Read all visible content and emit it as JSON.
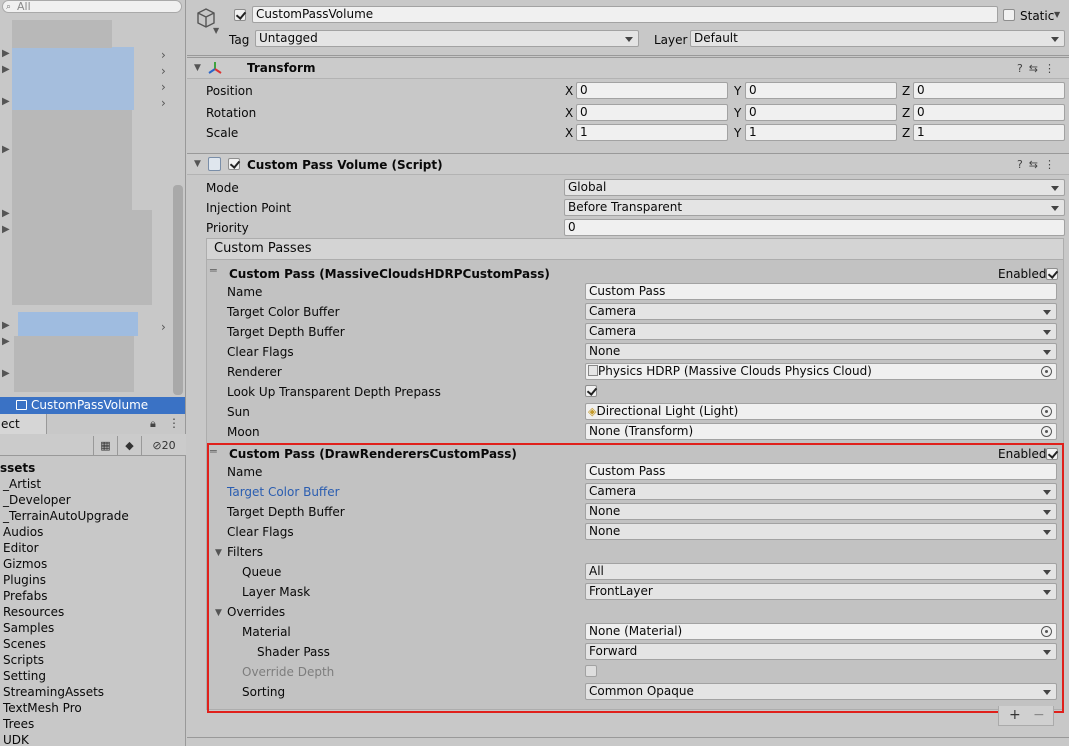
{
  "hierarchy": {
    "search_placeholder": "All",
    "selected_item": "CustomPassVolume"
  },
  "project": {
    "tab_label": "ect",
    "lock_icon": "lock-icon",
    "hidden_count": "20",
    "items": [
      "Assets",
      "_Artist",
      "_Developer",
      "_TerrainAutoUpgrade",
      "Audios",
      "Editor",
      "Gizmos",
      "Plugins",
      "Prefabs",
      "Resources",
      "Samples",
      "Scenes",
      "Scripts",
      "Setting",
      "StreamingAssets",
      "TextMesh Pro",
      "Trees",
      "UDK"
    ],
    "root_label": "ssets"
  },
  "inspector": {
    "object_name": "CustomPassVolume",
    "static_label": "Static",
    "tag_label": "Tag",
    "tag_value": "Untagged",
    "layer_label": "Layer",
    "layer_value": "Default",
    "transform": {
      "title": "Transform",
      "rows": [
        {
          "label": "Position",
          "x": "0",
          "y": "0",
          "z": "0"
        },
        {
          "label": "Rotation",
          "x": "0",
          "y": "0",
          "z": "0"
        },
        {
          "label": "Scale",
          "x": "1",
          "y": "1",
          "z": "1"
        }
      ],
      "axis_x": "X",
      "axis_y": "Y",
      "axis_z": "Z"
    },
    "cpv": {
      "title": "Custom Pass Volume (Script)",
      "mode_label": "Mode",
      "mode_value": "Global",
      "injection_label": "Injection Point",
      "injection_value": "Before Transparent",
      "priority_label": "Priority",
      "priority_value": "0",
      "passes_label": "Custom Passes"
    },
    "pass1": {
      "title": "Custom Pass (MassiveCloudsHDRPCustomPass)",
      "enabled_label": "Enabled",
      "name_label": "Name",
      "name_value": "Custom Pass",
      "color_label": "Target Color Buffer",
      "color_value": "Camera",
      "depth_label": "Target Depth Buffer",
      "depth_value": "Camera",
      "clear_label": "Clear Flags",
      "clear_value": "None",
      "renderer_label": "Renderer",
      "renderer_value": "Physics HDRP (Massive Clouds Physics Cloud)",
      "lookup_label": "Look Up Transparent Depth Prepass",
      "sun_label": "Sun",
      "sun_value": "Directional Light (Light)",
      "moon_label": "Moon",
      "moon_value": "None (Transform)"
    },
    "pass2": {
      "title": "Custom Pass (DrawRenderersCustomPass)",
      "enabled_label": "Enabled",
      "name_label": "Name",
      "name_value": "Custom Pass",
      "color_label": "Target Color Buffer",
      "color_value": "Camera",
      "depth_label": "Target Depth Buffer",
      "depth_value": "None",
      "clear_label": "Clear Flags",
      "clear_value": "None",
      "filters_label": "Filters",
      "queue_label": "Queue",
      "queue_value": "All",
      "layermask_label": "Layer Mask",
      "layermask_value": "FrontLayer",
      "overrides_label": "Overrides",
      "material_label": "Material",
      "material_value": "None (Material)",
      "shaderpass_label": "Shader Pass",
      "shaderpass_value": "Forward",
      "overridedepth_label": "Override Depth",
      "sorting_label": "Sorting",
      "sorting_value": "Common Opaque"
    },
    "add_label": "+",
    "remove_label": "−"
  },
  "colors": {
    "selection": "#3a72c5",
    "highlight": "#e0201b",
    "link_label": "#2a5db0"
  }
}
